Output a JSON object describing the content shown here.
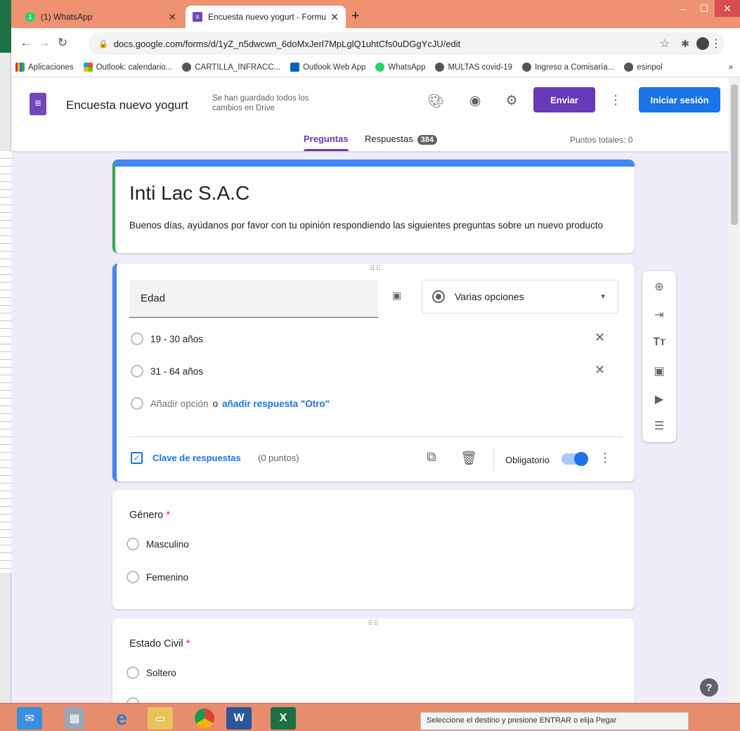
{
  "browser": {
    "tabs": [
      {
        "label": "(1) WhatsApp"
      },
      {
        "label": "Encuesta nuevo yogurt - Formula"
      }
    ],
    "url": "docs.google.com/forms/d/1yZ_n5dwcwn_6doMxJerl7MpLglQ1uhtCfs0uDGgYcJU/edit",
    "bookmarks": [
      {
        "label": "Aplicaciones",
        "icon": "apps-grid-icon"
      },
      {
        "label": "Outlook: calendario...",
        "icon": "outlook-icon"
      },
      {
        "label": "CARTILLA_INFRACC...",
        "icon": "globe-icon"
      },
      {
        "label": "Outlook Web App",
        "icon": "outlook-icon"
      },
      {
        "label": "WhatsApp",
        "icon": "whatsapp-icon"
      },
      {
        "label": "MULTAS covid-19",
        "icon": "globe-icon"
      },
      {
        "label": "Ingreso a Comisaría...",
        "icon": "globe-icon"
      },
      {
        "label": "esinpol",
        "icon": "globe-icon"
      }
    ],
    "bookmarks_overflow": "»"
  },
  "forms": {
    "doc_title": "Encuesta nuevo yogurt",
    "save_status": "Se han guardado todos los cambios en Drive",
    "send_label": "Enviar",
    "login_label": "Iniciar sesión",
    "tab_questions": "Preguntas",
    "tab_responses": "Respuestas",
    "response_count": "384",
    "total_points": "Puntos totales: 0"
  },
  "title_card": {
    "title": "Inti Lac S.A.C",
    "description": "Buenos días, ayúdanos por favor con tu opinión respondiendo las siguientes preguntas sobre un nuevo producto"
  },
  "q1": {
    "title": "Edad",
    "type": "Varias opciones",
    "options": [
      "19 - 30 años",
      "31 - 64 años"
    ],
    "add_option": "Añadir opción",
    "or": "o",
    "add_other": "añadir respuesta \"Otro\"",
    "answer_key": "Clave de respuestas",
    "points": "(0 puntos)",
    "required_label": "Obligatorio",
    "required": true
  },
  "q2": {
    "title": "Género",
    "required_mark": "*",
    "options": [
      "Masculino",
      "Femenino"
    ]
  },
  "q3": {
    "title": "Estado Civil",
    "required_mark": "*",
    "options": [
      "Soltero"
    ]
  },
  "taskbar": {
    "status": "Seleccione el destino y presione ENTRAR o elija Pegar"
  },
  "colors": {
    "forms_purple": "#673ab7",
    "google_blue": "#1a73e8",
    "page_bg": "#f0ebf8"
  }
}
